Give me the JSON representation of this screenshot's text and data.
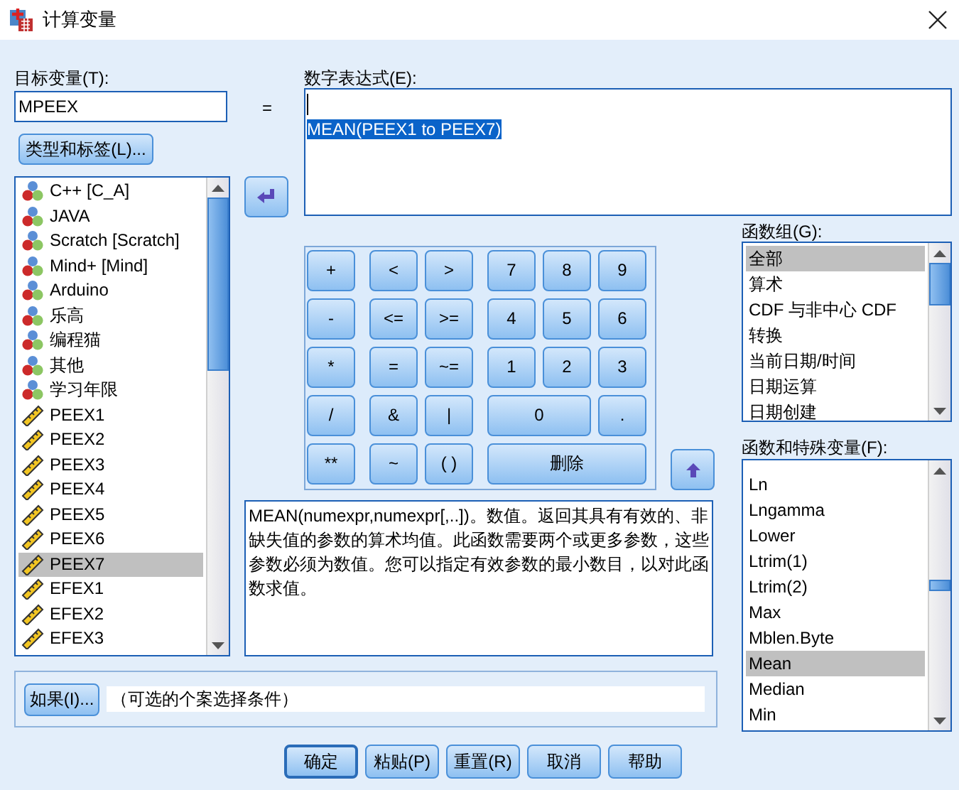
{
  "window": {
    "title": "计算变量"
  },
  "target": {
    "label": "目标变量(T):",
    "value": "MPEEX"
  },
  "equals": "=",
  "type_button": "类型和标签(L)...",
  "expression": {
    "label": "数字表达式(E):",
    "text": "MEAN(PEEX1 to PEEX7)",
    "selected": true
  },
  "variables": [
    {
      "name": "C++ [C_A]",
      "kind": "nominal",
      "selected": false
    },
    {
      "name": "JAVA",
      "kind": "nominal",
      "selected": false
    },
    {
      "name": "Scratch  [Scratch]",
      "kind": "nominal",
      "selected": false
    },
    {
      "name": "Mind+ [Mind]",
      "kind": "nominal",
      "selected": false
    },
    {
      "name": "Arduino",
      "kind": "nominal",
      "selected": false
    },
    {
      "name": "乐高",
      "kind": "nominal",
      "selected": false
    },
    {
      "name": "编程猫",
      "kind": "nominal",
      "selected": false
    },
    {
      "name": "其他",
      "kind": "nominal",
      "selected": false
    },
    {
      "name": "学习年限",
      "kind": "nominal",
      "selected": false
    },
    {
      "name": "PEEX1",
      "kind": "scale",
      "selected": false
    },
    {
      "name": "PEEX2",
      "kind": "scale",
      "selected": false
    },
    {
      "name": "PEEX3",
      "kind": "scale",
      "selected": false
    },
    {
      "name": "PEEX4",
      "kind": "scale",
      "selected": false
    },
    {
      "name": "PEEX5",
      "kind": "scale",
      "selected": false
    },
    {
      "name": "PEEX6",
      "kind": "scale",
      "selected": false
    },
    {
      "name": "PEEX7",
      "kind": "scale",
      "selected": true
    },
    {
      "name": "EFEX1",
      "kind": "scale",
      "selected": false
    },
    {
      "name": "EFEX2",
      "kind": "scale",
      "selected": false
    },
    {
      "name": "EFEX3",
      "kind": "scale",
      "selected": false
    }
  ],
  "keypad": [
    [
      "+",
      "<",
      ">",
      "7",
      "8",
      "9"
    ],
    [
      "-",
      "<=",
      ">=",
      "4",
      "5",
      "6"
    ],
    [
      "*",
      "=",
      "~=",
      "1",
      "2",
      "3"
    ],
    [
      "/",
      "&",
      "|",
      "0",
      "."
    ],
    [
      "**",
      "~",
      "( )",
      "删除"
    ]
  ],
  "function_groups": {
    "label": "函数组(G):",
    "items": [
      {
        "name": "全部",
        "selected": true
      },
      {
        "name": "算术",
        "selected": false
      },
      {
        "name": "CDF 与非中心 CDF",
        "selected": false
      },
      {
        "name": "转换",
        "selected": false
      },
      {
        "name": "当前日期/时间",
        "selected": false
      },
      {
        "name": "日期运算",
        "selected": false
      },
      {
        "name": "日期创建",
        "selected": false
      }
    ]
  },
  "functions": {
    "label": "函数和特殊变量(F):",
    "items": [
      {
        "name": "Ln",
        "selected": false
      },
      {
        "name": "Lngamma",
        "selected": false
      },
      {
        "name": "Lower",
        "selected": false
      },
      {
        "name": "Ltrim(1)",
        "selected": false
      },
      {
        "name": "Ltrim(2)",
        "selected": false
      },
      {
        "name": "Max",
        "selected": false
      },
      {
        "name": "Mblen.Byte",
        "selected": false
      },
      {
        "name": "Mean",
        "selected": true
      },
      {
        "name": "Median",
        "selected": false
      },
      {
        "name": "Min",
        "selected": false
      }
    ]
  },
  "description": "MEAN(numexpr,numexpr[,..])。数值。返回其具有有效的、非缺失值的参数的算术均值。此函数需要两个或更多参数，这些参数必须为数值。您可以指定有效参数的最小数目，以对此函数求值。",
  "if": {
    "button": "如果(I)...",
    "condition": "（可选的个案选择条件）"
  },
  "buttons": [
    {
      "label": "确定",
      "default": true
    },
    {
      "label": "粘贴(P)",
      "default": false
    },
    {
      "label": "重置(R)",
      "default": false
    },
    {
      "label": "取消",
      "default": false
    },
    {
      "label": "帮助",
      "default": false
    }
  ]
}
